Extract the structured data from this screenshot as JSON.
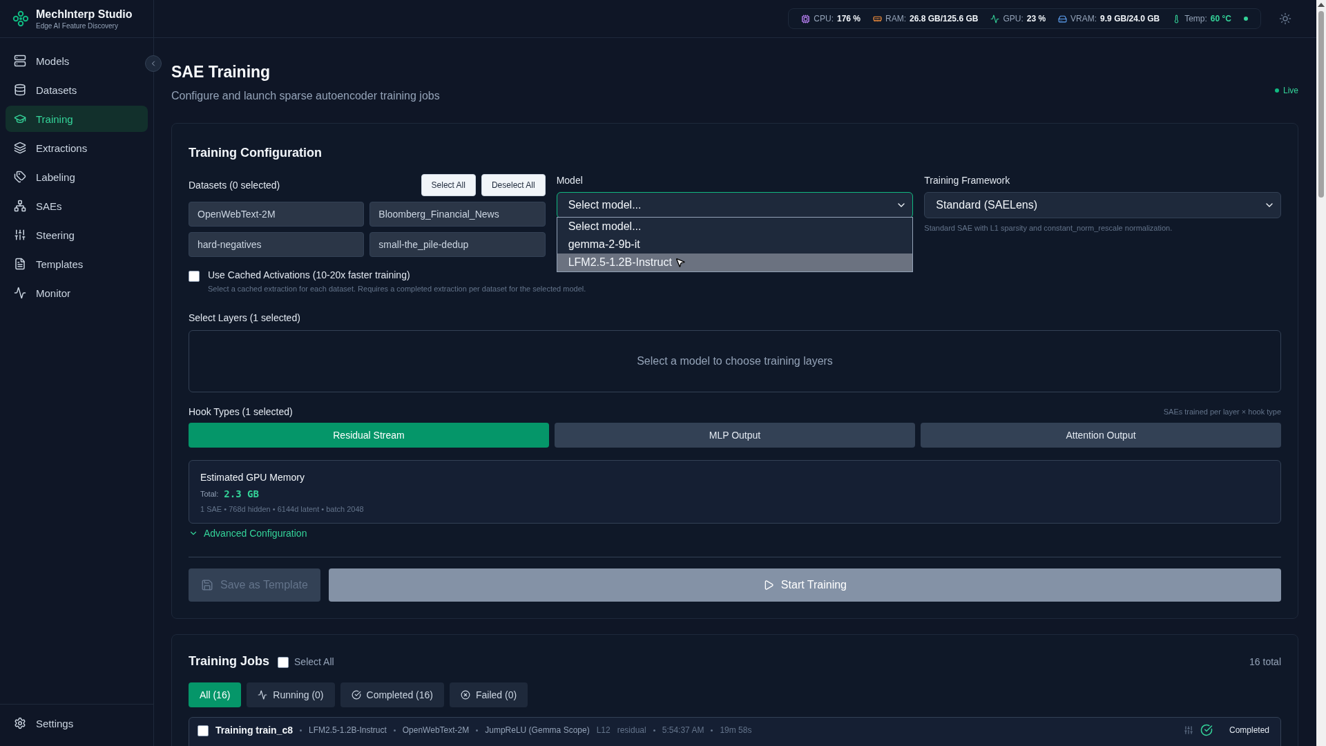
{
  "app": {
    "name": "MechInterp Studio",
    "tagline": "Edge AI Feature Discovery"
  },
  "sidebar": {
    "items": [
      {
        "label": "Models",
        "selected": false
      },
      {
        "label": "Datasets",
        "selected": false
      },
      {
        "label": "Training",
        "selected": true
      },
      {
        "label": "Extractions",
        "selected": false
      },
      {
        "label": "Labeling",
        "selected": false
      },
      {
        "label": "SAEs",
        "selected": false
      },
      {
        "label": "Steering",
        "selected": false
      },
      {
        "label": "Templates",
        "selected": false
      },
      {
        "label": "Monitor",
        "selected": false
      }
    ],
    "footer_item": {
      "label": "Settings",
      "selected": false
    }
  },
  "system_stats": [
    {
      "label": "CPU:",
      "value": "176 %"
    },
    {
      "label": "RAM:",
      "value": "26.8 GB/125.6 GB"
    },
    {
      "label": "GPU:",
      "value": "23 %"
    },
    {
      "label": "VRAM:",
      "value": "9.9 GB/24.0 GB"
    },
    {
      "label": "Temp:",
      "value": "60 °C"
    }
  ],
  "page": {
    "title": "SAE Training",
    "subtitle": "Configure and launch sparse autoencoder training jobs",
    "live_label": "Live"
  },
  "config": {
    "title": "Training Configuration",
    "datasets": {
      "label": "Datasets (0 selected)",
      "select_all": "Select All",
      "deselect_all": "Deselect All",
      "items": [
        {
          "label": "OpenWebText-2M",
          "selected": false
        },
        {
          "label": "Bloomberg_Financial_News",
          "selected": false
        },
        {
          "label": "hard-negatives",
          "selected": false
        },
        {
          "label": "small-the_pile-dedup",
          "selected": false
        }
      ]
    },
    "model": {
      "label": "Model",
      "value": "Select model...",
      "expanded": true,
      "options": [
        {
          "label": "Select model...",
          "highlighted": false
        },
        {
          "label": "gemma-2-9b-it",
          "highlighted": false
        },
        {
          "label": "LFM2.5-1.2B-Instruct",
          "highlighted": true
        }
      ]
    },
    "framework": {
      "label": "Training Framework",
      "value": "Standard (SAELens)",
      "hint": "Standard SAE with L1 sparsity and constant_norm_rescale normalization."
    },
    "cached": {
      "label": "Use Cached Activations (10-20x faster training)",
      "checked": false,
      "hint": "Select a cached extraction for each dataset. Requires a completed extraction per dataset for the selected model."
    },
    "layers": {
      "label": "Select Layers (1 selected)",
      "empty_text": "Select a model to choose training layers"
    },
    "hooks": {
      "label": "Hook Types (1 selected)",
      "note": "SAEs trained per layer × hook type",
      "items": [
        {
          "label": "Residual Stream",
          "selected": true
        },
        {
          "label": "MLP Output",
          "selected": false
        },
        {
          "label": "Attention Output",
          "selected": false
        }
      ]
    },
    "memory": {
      "title": "Estimated GPU Memory",
      "total_label": "Total:",
      "total_value": "2.3 GB",
      "detail": "1 SAE • 768d hidden • 6144d latent • batch 2048"
    },
    "advanced": {
      "label": "Advanced Configuration",
      "expanded": false
    },
    "save_button": {
      "label": "Save as Template",
      "disabled": true
    },
    "start_button": {
      "label": "Start Training",
      "disabled": true
    }
  },
  "jobs": {
    "title": "Training Jobs",
    "select_all": {
      "label": "Select All",
      "checked": false
    },
    "total": "16 total",
    "filters": [
      {
        "label": "All (16)",
        "selected": true
      },
      {
        "label": "Running (0)",
        "selected": false
      },
      {
        "label": "Completed (16)",
        "selected": false
      },
      {
        "label": "Failed (0)",
        "selected": false
      }
    ],
    "rows": [
      {
        "title": "Training train_c8",
        "checked": false,
        "meta": [
          "LFM2.5-1.2B-Instruct",
          "OpenWebText-2M",
          "JumpReLU (Gemma Scope)"
        ],
        "layer": "L12",
        "hook": "residual",
        "time": "5:54:37 AM",
        "duration": "19m 58s",
        "status": "Completed"
      }
    ]
  }
}
